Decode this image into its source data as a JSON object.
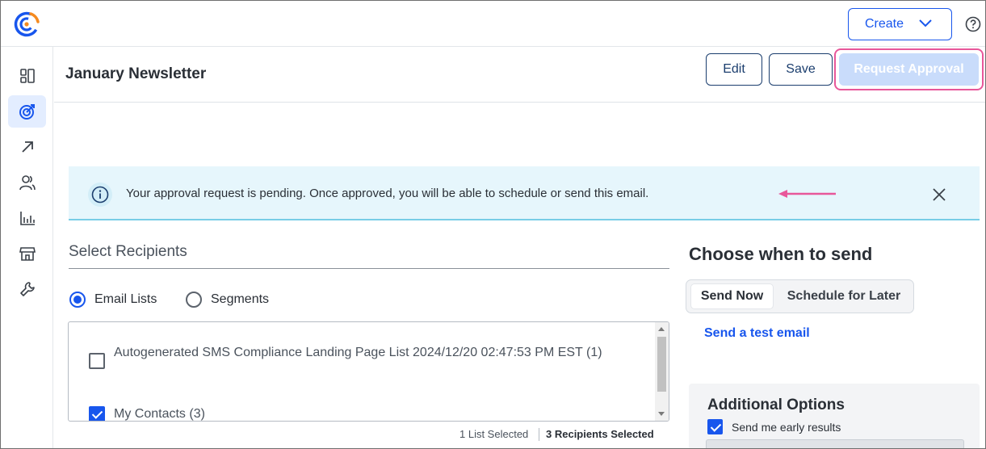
{
  "topbar": {
    "logo_icon": "constant-contact-logo",
    "create_label": "Create",
    "help_icon": "question-circle-icon"
  },
  "sidebar": {
    "items": [
      {
        "icon": "dashboard-icon",
        "active": false
      },
      {
        "icon": "campaigns-target-icon",
        "active": true
      },
      {
        "icon": "arrow-up-right-icon",
        "active": false
      },
      {
        "icon": "contacts-icon",
        "active": false
      },
      {
        "icon": "reporting-chart-icon",
        "active": false
      },
      {
        "icon": "storefront-icon",
        "active": false
      },
      {
        "icon": "wrench-tools-icon",
        "active": false
      }
    ]
  },
  "header": {
    "title": "January Newsletter",
    "edit_label": "Edit",
    "save_label": "Save",
    "request_approval_label": "Request Approval"
  },
  "banner": {
    "text": "Your approval request is pending. Once approved, you will be able to schedule or send this email.",
    "accent_color": "#78cde6",
    "annotation_color": "#e8579a"
  },
  "recipients": {
    "title": "Select Recipients",
    "radio_options": [
      {
        "label": "Email Lists",
        "checked": true
      },
      {
        "label": "Segments",
        "checked": false
      }
    ],
    "lists": [
      {
        "label": "Autogenerated SMS Compliance Landing Page List 2024/12/20 02:47:53 PM EST (1)",
        "checked": false
      },
      {
        "label": "My Contacts (3)",
        "checked": true
      }
    ],
    "list_selected": "1 List Selected",
    "recipients_selected": "3 Recipients Selected"
  },
  "send": {
    "title": "Choose when to send",
    "send_now": "Send Now",
    "schedule_later": "Schedule for Later",
    "test_link": "Send a test email"
  },
  "options": {
    "title": "Additional Options",
    "early_results_label": "Send me early results",
    "early_results_checked": true
  },
  "colors": {
    "primary": "#1856ed",
    "disabled_button": "#c9dcfb"
  }
}
